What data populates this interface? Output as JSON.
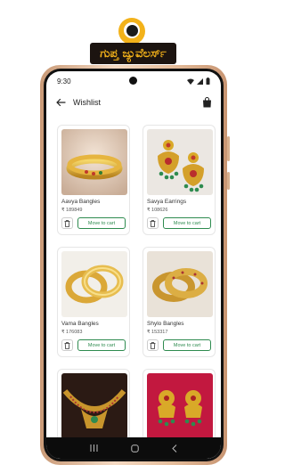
{
  "logo": {
    "text": "ಗುಪ್ತ ಜ್ಯುವೆಲರ್ಸ್",
    "color": "#f3b21a"
  },
  "status_bar": {
    "time": "9:30"
  },
  "header": {
    "title": "Wishlist"
  },
  "products": [
    {
      "name": "Aavya Bangles",
      "price": "₹ 189849",
      "move_label": "Move to cart"
    },
    {
      "name": "Savya Earrings",
      "price": "₹ 108626",
      "move_label": "Move to cart"
    },
    {
      "name": "Vama Bangles",
      "price": "₹ 176083",
      "move_label": "Move to cart"
    },
    {
      "name": "Shylo Bangles",
      "price": "₹ 153317",
      "move_label": "Move to cart"
    }
  ],
  "colors": {
    "accent_green": "#2e8b4f",
    "phone_frame": "#e5bd9b"
  }
}
